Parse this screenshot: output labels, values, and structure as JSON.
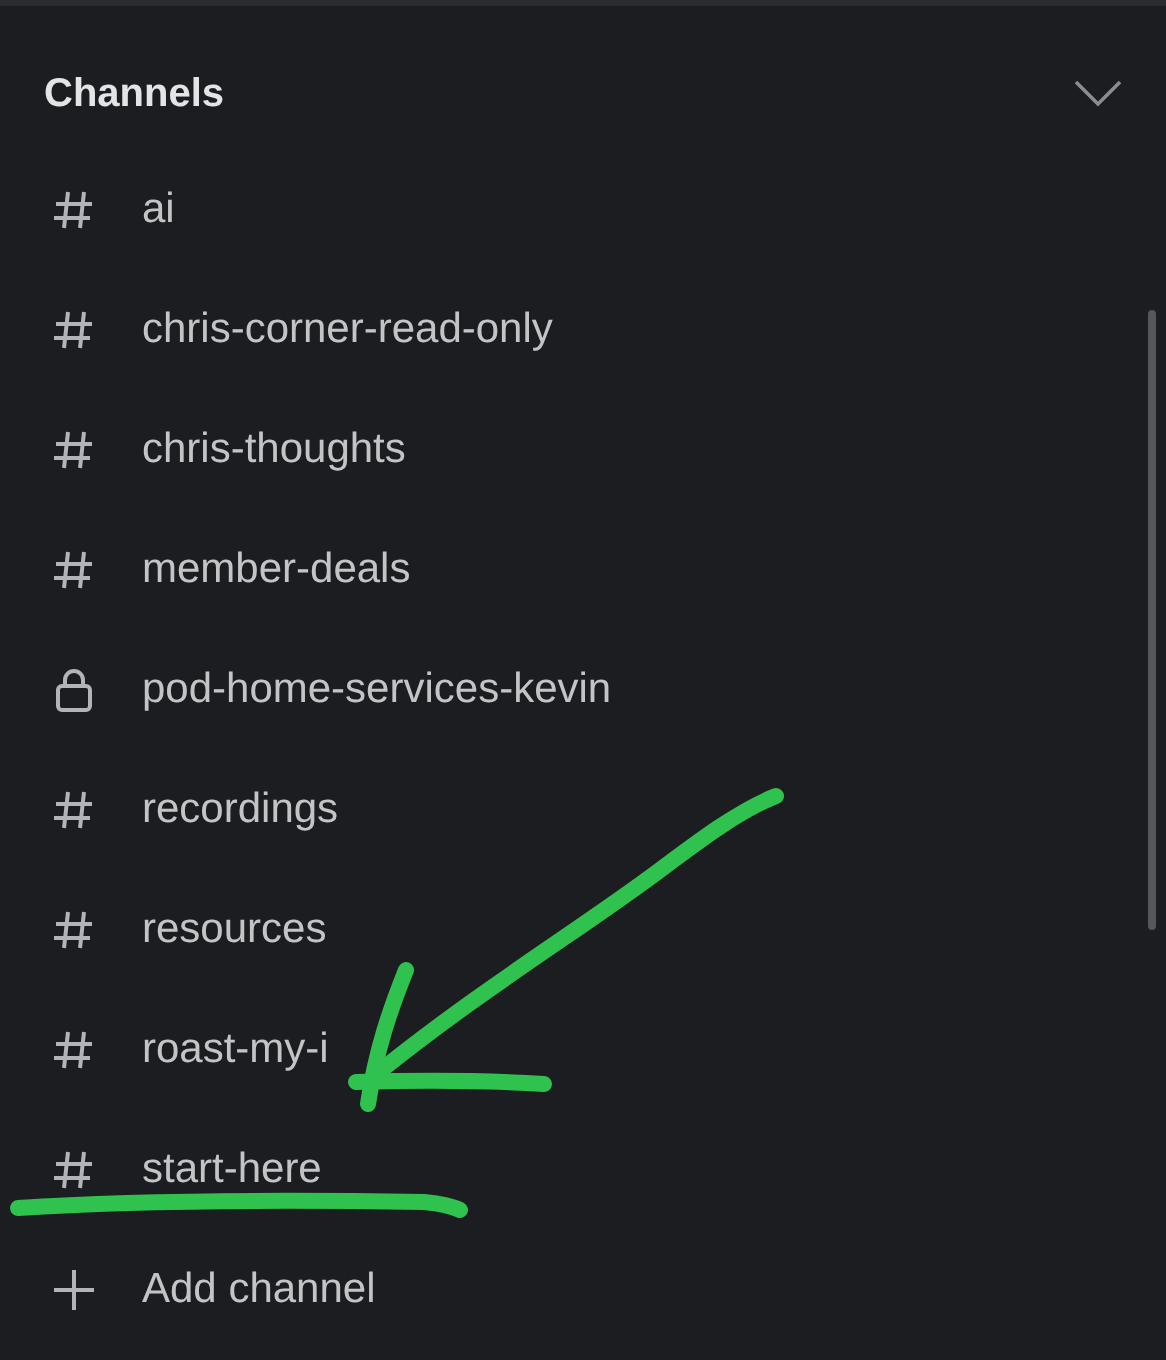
{
  "section": {
    "title": "Channels",
    "expanded": true
  },
  "channels": [
    {
      "kind": "hash",
      "name": "ai"
    },
    {
      "kind": "hash",
      "name": "chris-corner-read-only"
    },
    {
      "kind": "hash",
      "name": "chris-thoughts"
    },
    {
      "kind": "hash",
      "name": "member-deals"
    },
    {
      "kind": "lock",
      "name": "pod-home-services-kevin"
    },
    {
      "kind": "hash",
      "name": "recordings"
    },
    {
      "kind": "hash",
      "name": "resources"
    },
    {
      "kind": "hash",
      "name": "roast-my-i"
    },
    {
      "kind": "hash",
      "name": "start-here"
    },
    {
      "kind": "add",
      "name": "Add channel"
    }
  ]
}
